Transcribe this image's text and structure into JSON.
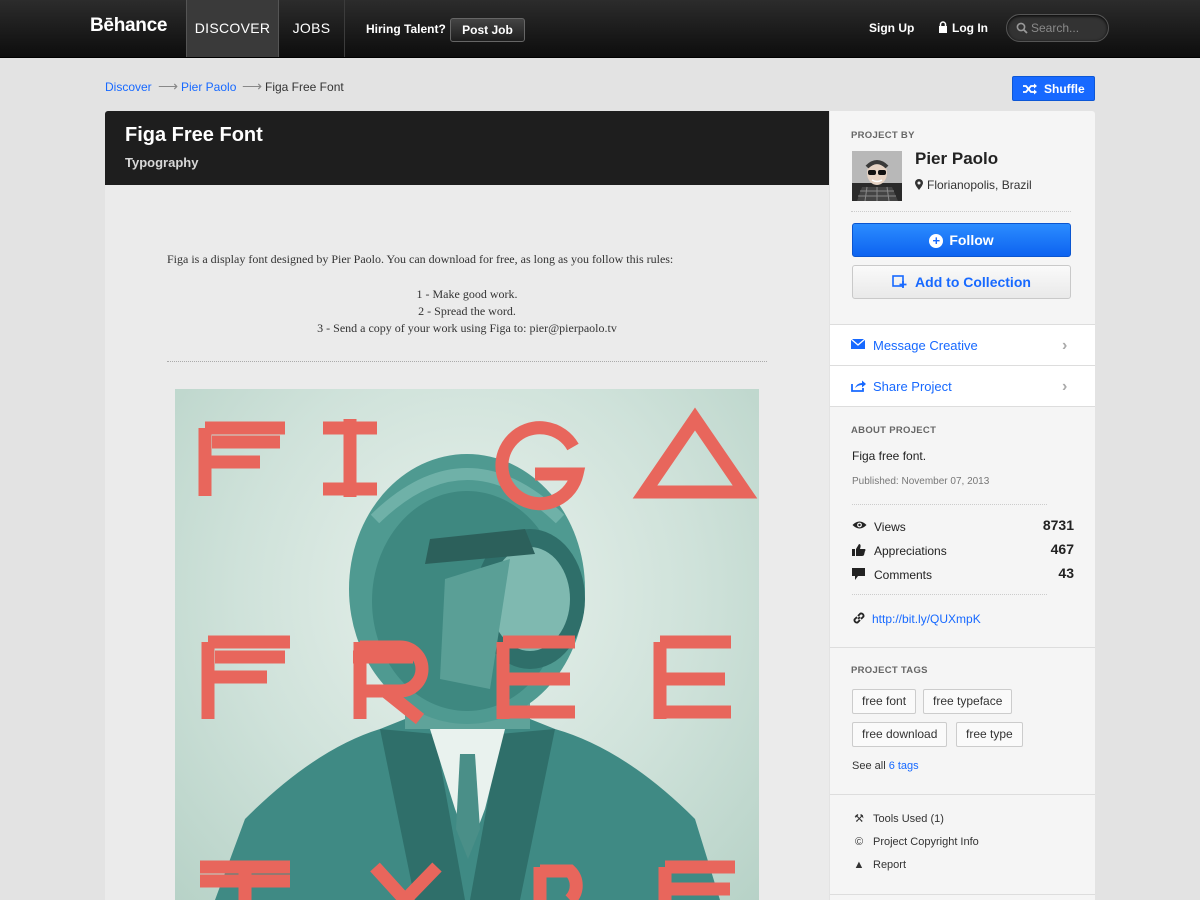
{
  "topbar": {
    "logo": "Bēhance",
    "nav": {
      "discover": "DISCOVER",
      "jobs": "JOBS"
    },
    "hiring_label": "Hiring Talent?",
    "post_job": "Post Job",
    "sign_up": "Sign Up",
    "log_in": "Log In",
    "search_placeholder": "Search..."
  },
  "breadcrumb": {
    "items": [
      "Discover",
      "Pier Paolo",
      "Figa Free Font"
    ],
    "separator": "⟶"
  },
  "shuffle_label": "Shuffle",
  "project": {
    "title": "Figa Free Font",
    "category": "Typography",
    "description": "Figa is a display font designed by Pier Paolo. You can download for free, as long as you follow this rules:",
    "rules": [
      "1 - Make good work.",
      "2 - Spread the word.",
      "3 - Send a copy of your work using Figa to: pier@pierpaolo.tv"
    ],
    "poster_letters": [
      "FIGA",
      "FREE",
      "TYPE"
    ]
  },
  "sidebar": {
    "project_by_label": "PROJECT BY",
    "owner": {
      "name": "Pier Paolo",
      "location": "Florianopolis, Brazil"
    },
    "follow": "Follow",
    "add_to_collection": "Add to Collection",
    "message_creative": "Message Creative",
    "share_project": "Share Project",
    "about_label": "ABOUT PROJECT",
    "about_text": "Figa free font.",
    "published": "Published: November 07, 2013",
    "stats": [
      {
        "label": "Views",
        "value": "8731",
        "icon": "eye-icon"
      },
      {
        "label": "Appreciations",
        "value": "467",
        "icon": "thumbs-up-icon"
      },
      {
        "label": "Comments",
        "value": "43",
        "icon": "comment-icon"
      }
    ],
    "short_link": "http://bit.ly/QUXmpK",
    "tags_label": "PROJECT TAGS",
    "tags": [
      "free font",
      "free typeface",
      "free download",
      "free type"
    ],
    "see_all_prefix": "See all",
    "see_all_link": "6 tags",
    "footer": {
      "tools": "Tools Used (1)",
      "copyright": "Project Copyright Info",
      "report": "Report"
    }
  },
  "colors": {
    "accent": "#1769ff",
    "topbar": "#111111",
    "poster_letters": "#e8665c",
    "poster_teal": "#3f8a84"
  }
}
